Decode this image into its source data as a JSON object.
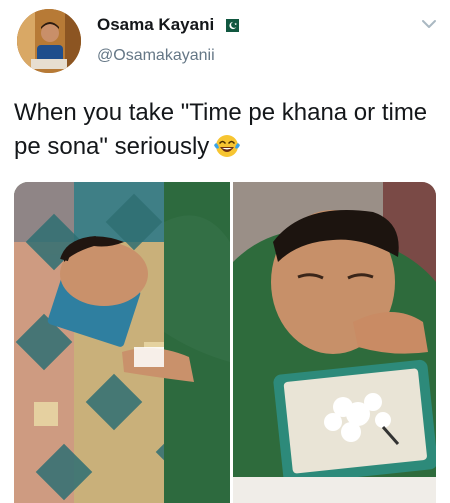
{
  "user": {
    "display_name": "Osama Kayani",
    "handle": "@Osamakayanii",
    "verified_flag": "pakistan-flag-icon"
  },
  "tweet": {
    "text": "When you take \"Time pe khana or time pe sona\" seriously",
    "emoji": "laughing-with-tears-emoji"
  },
  "media": {
    "photos": [
      {
        "name": "photo-sleeping-on-clock"
      },
      {
        "name": "photo-eating-off-clock"
      }
    ]
  },
  "colors": {
    "text": "#14171a",
    "secondary_text": "#657786",
    "flag_green": "#115740"
  }
}
